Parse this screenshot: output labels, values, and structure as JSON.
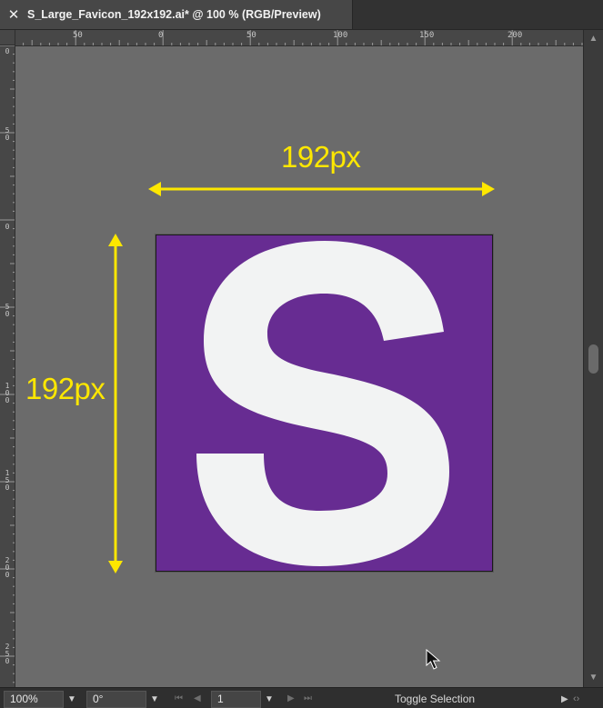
{
  "tab": {
    "close_glyph": "✕",
    "title": "S_Large_Favicon_192x192.ai* @ 100 % (RGB/Preview)"
  },
  "ruler": {
    "top_labels": [
      "50",
      "0",
      "50",
      "100",
      "150",
      "200"
    ],
    "left_labels": [
      "0",
      "50",
      "0",
      "50",
      "100",
      "150",
      "200",
      "250"
    ]
  },
  "canvas": {
    "width_label": "192px",
    "height_label": "192px",
    "artboard_letter": "S",
    "artboard_color": "#672c92",
    "letter_color": "#f2f3f3",
    "annotation_color": "#fde700"
  },
  "status": {
    "zoom": "100%",
    "rotation": "0°",
    "artboard_number": "1",
    "toggle_label": "Toggle Selection"
  },
  "icons": {
    "close": "close-icon",
    "dropdown": "chevron-down-icon",
    "first": "first-artboard-icon",
    "prev": "previous-artboard-icon",
    "next": "next-artboard-icon",
    "last": "last-artboard-icon",
    "play": "play-icon",
    "cursor": "mouse-pointer-icon"
  }
}
